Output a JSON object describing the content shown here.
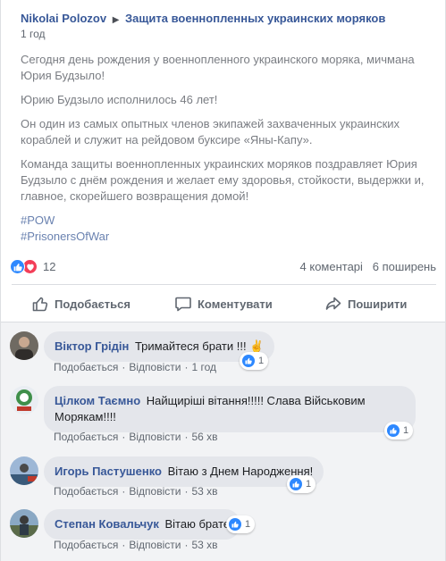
{
  "post": {
    "author": "Nikolai Polozov",
    "page": "Защита военнопленных украинских моряков",
    "time": "1 год",
    "paragraphs": [
      "Сегодня день рождения у военнопленного украинского моряка, мичмана Юрия Будзыло!",
      "Юрию Будзыло исполнилось 46 лет!",
      "Он один из самых опытных членов экипажей захваченных украинских кораблей и служит на рейдовом буксире «Яны-Капу».",
      "Команда защиты военнопленных украинских моряков поздравляет Юрия Будзыло с днём рождения и желает ему здоровья, стойкости, выдержки и, главное, скорейшего возвращения домой!"
    ],
    "hashtags": [
      "#POW",
      "#PrisonersOfWar"
    ]
  },
  "stats": {
    "reactions": "12",
    "comments": "4 коментарі",
    "shares": "6 поширень"
  },
  "actions": {
    "like": "Подобається",
    "comment": "Коментувати",
    "share": "Поширити"
  },
  "comments": [
    {
      "name": "Віктор Грідін",
      "text": "Тримайтеся брати !!! ✌",
      "like": "Подобається",
      "reply": "Відповісти",
      "time": "1 год",
      "reactions": "1"
    },
    {
      "name": "Цілком Таємно",
      "text": "Найщиріші вітання!!!!! Слава Військовим Морякам!!!!",
      "like": "Подобається",
      "reply": "Відповісти",
      "time": "56 хв",
      "reactions": "1"
    },
    {
      "name": "Игорь Пастушенко",
      "text": "Вітаю з Днем Народження!",
      "like": "Подобається",
      "reply": "Відповісти",
      "time": "53 хв",
      "reactions": "1"
    },
    {
      "name": "Степан Ковальчук",
      "text": "Вітаю брате",
      "like": "Подобається",
      "reply": "Відповісти",
      "time": "53 хв",
      "reactions": "1"
    }
  ],
  "colors": {
    "link": "#385898",
    "like_blue": "#2d88ff",
    "love_red": "#f33e58",
    "comment_bubble": "#e4e6eb",
    "comments_bg": "#f2f3f5"
  }
}
